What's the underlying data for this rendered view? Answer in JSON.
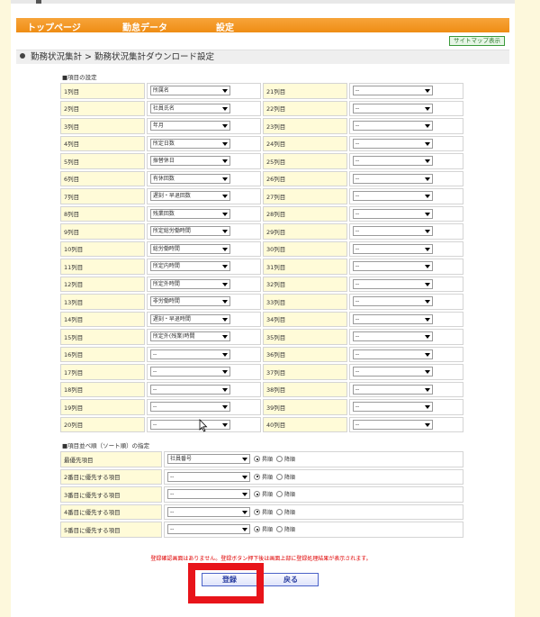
{
  "nav": {
    "items": [
      "トップページ",
      "勤怠データ",
      "設定"
    ]
  },
  "sitemap_label": "サイトマップ表示",
  "breadcrumb": {
    "part1": "勤務状況集計",
    "sep": ">",
    "part2": "勤務状況集計ダウンロード設定"
  },
  "section1_title": "■項目の設定",
  "section2_title": "■項目並べ順（ソート順）の指定",
  "columns_left": [
    {
      "label": "1列目",
      "value": "所属名"
    },
    {
      "label": "2列目",
      "value": "社員氏名"
    },
    {
      "label": "3列目",
      "value": "年月"
    },
    {
      "label": "4列目",
      "value": "所定日数"
    },
    {
      "label": "5列目",
      "value": "振替休日"
    },
    {
      "label": "6列目",
      "value": "有休回数"
    },
    {
      "label": "7列目",
      "value": "遅刻・早退回数"
    },
    {
      "label": "8列目",
      "value": "残業回数"
    },
    {
      "label": "9列目",
      "value": "所定総労働時間"
    },
    {
      "label": "10列目",
      "value": "総労働時間"
    },
    {
      "label": "11列目",
      "value": "所定内時間"
    },
    {
      "label": "12列目",
      "value": "所定外時間"
    },
    {
      "label": "13列目",
      "value": "非労働時間"
    },
    {
      "label": "14列目",
      "value": "遅刻・早退時間"
    },
    {
      "label": "15列目",
      "value": "所定外(残業)時間"
    },
    {
      "label": "16列目",
      "value": "--"
    },
    {
      "label": "17列目",
      "value": "--"
    },
    {
      "label": "18列目",
      "value": "--"
    },
    {
      "label": "19列目",
      "value": "--"
    },
    {
      "label": "20列目",
      "value": "--"
    }
  ],
  "columns_right": [
    {
      "label": "21列目",
      "value": "--"
    },
    {
      "label": "22列目",
      "value": "--"
    },
    {
      "label": "23列目",
      "value": "--"
    },
    {
      "label": "24列目",
      "value": "--"
    },
    {
      "label": "25列目",
      "value": "--"
    },
    {
      "label": "26列目",
      "value": "--"
    },
    {
      "label": "27列目",
      "value": "--"
    },
    {
      "label": "28列目",
      "value": "--"
    },
    {
      "label": "29列目",
      "value": "--"
    },
    {
      "label": "30列目",
      "value": "--"
    },
    {
      "label": "31列目",
      "value": "--"
    },
    {
      "label": "32列目",
      "value": "--"
    },
    {
      "label": "33列目",
      "value": "--"
    },
    {
      "label": "34列目",
      "value": "--"
    },
    {
      "label": "35列目",
      "value": "--"
    },
    {
      "label": "36列目",
      "value": "--"
    },
    {
      "label": "37列目",
      "value": "--"
    },
    {
      "label": "38列目",
      "value": "--"
    },
    {
      "label": "39列目",
      "value": "--"
    },
    {
      "label": "40列目",
      "value": "--"
    }
  ],
  "sort_rows": [
    {
      "label": "最優先項目",
      "value": "社員番号",
      "asc": "昇順",
      "desc": "降順"
    },
    {
      "label": "2番目に優先する項目",
      "value": "--",
      "asc": "昇順",
      "desc": "降順"
    },
    {
      "label": "3番目に優先する項目",
      "value": "--",
      "asc": "昇順",
      "desc": "降順"
    },
    {
      "label": "4番目に優先する項目",
      "value": "--",
      "asc": "昇順",
      "desc": "降順"
    },
    {
      "label": "5番目に優先する項目",
      "value": "--",
      "asc": "昇順",
      "desc": "降順"
    }
  ],
  "notice": "登録確認画面はありません。登録ボタン押下後は画面上部に登録処理結果が表示されます。",
  "buttons": {
    "save": "登録",
    "back": "戻る"
  },
  "colors": {
    "nav": "#ef8d14",
    "label_bg": "#fffbd8",
    "highlight": "#e8141a",
    "notice": "#e00000"
  }
}
